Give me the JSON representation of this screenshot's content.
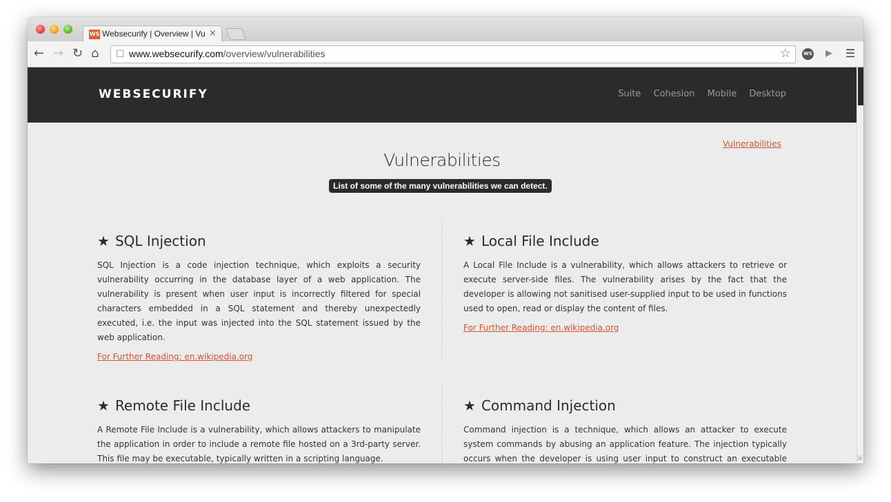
{
  "browser": {
    "tab_favicon": "WS",
    "tab_title": "Websecurify | Overview | Vul",
    "tab_close": "×",
    "url_host": "www.websecurify.com",
    "url_path": "/overview/vulnerabilities",
    "icons": [
      "back-arrow-icon",
      "forward-arrow-icon",
      "reload-icon",
      "home-icon",
      "page-icon",
      "star-icon",
      "websecurify-extension-icon",
      "share-icon",
      "menu-icon"
    ]
  },
  "site": {
    "logo": "WEBSECURIFY",
    "nav": [
      "Suite",
      "Cohesion",
      "Mobile",
      "Desktop"
    ],
    "breadcrumb": "Vulnerabilities",
    "title": "Vulnerabilities",
    "subtitle": "List of some of the many vulnerabilities we can detect."
  },
  "cards": [
    {
      "title": "SQL Injection",
      "body": "SQL Injection is a code injection technique, which exploits a security vulnerability occurring in the database layer of a web application. The vulnerability is present when user input is incorrectly filtered for special characters embedded in a SQL statement and thereby unexpectedly executed, i.e. the input was injected into the SQL statement issued by the web application.",
      "link": "For Further Reading: en.wikipedia.org"
    },
    {
      "title": "Local File Include",
      "body": "A Local File Include is a vulnerability, which allows attackers to retrieve or execute server-side files. The vulnerability arises by the fact that the developer is allowing not sanitised user-supplied input to be used in functions used to open, read or display the content of files.",
      "link": "For Further Reading: en.wikipedia.org"
    },
    {
      "title": "Remote File Include",
      "body": "A Remote File Include is a vulnerability, which allows attackers to manipulate the application in order to include a remote file hosted on a 3rd-party server. This file may be executable, typically written in a scripting language."
    },
    {
      "title": "Command Injection",
      "body": "Command injection is a technique, which allows an attacker to execute system commands by abusing an application feature. The injection typically occurs when the developer is using user input to construct an executable command."
    }
  ],
  "colors": {
    "header_bg": "#2b2b2b",
    "accent": "#d2542f",
    "page_bg": "#ececec"
  }
}
